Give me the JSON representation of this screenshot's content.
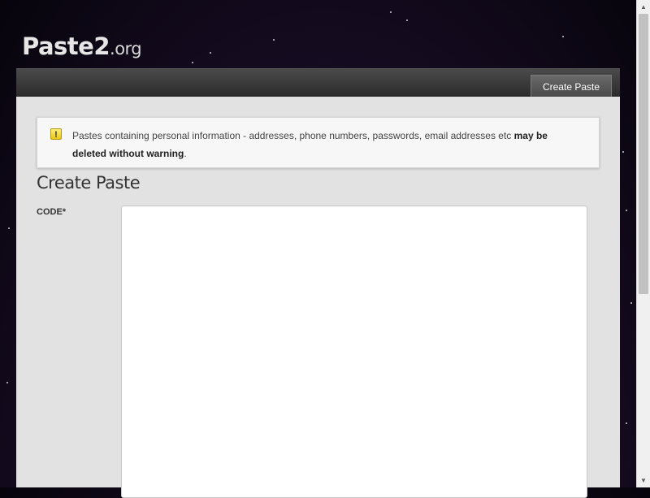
{
  "logo": {
    "main": "Paste2",
    "tld": ".org"
  },
  "nav": {
    "create_paste_label": "Create Paste"
  },
  "notice": {
    "icon": "warning-icon",
    "text": "Pastes containing personal information - addresses, phone numbers, passwords, email addresses etc ",
    "bold_text": "may be deleted without warning",
    "suffix": "."
  },
  "page": {
    "title": "Create Paste"
  },
  "form": {
    "code_label": "CODE*",
    "code_value": ""
  }
}
